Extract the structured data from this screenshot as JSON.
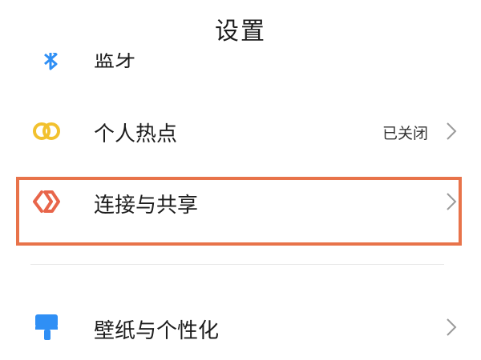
{
  "header": {
    "title": "设置"
  },
  "clipped_item": {
    "label": "蓝牙",
    "icon": "bluetooth-icon"
  },
  "items": [
    {
      "label": "个人热点",
      "value": "已关闭",
      "icon": "hotspot-icon",
      "icon_color": "#f2c12e"
    },
    {
      "label": "连接与共享",
      "value": "",
      "icon": "connection-sharing-icon",
      "icon_color": "#e8654a"
    },
    {
      "label": "壁纸与个性化",
      "value": "",
      "icon": "wallpaper-brush-icon",
      "icon_color": "#2f8ff5"
    }
  ],
  "highlight_color": "#e8734a"
}
